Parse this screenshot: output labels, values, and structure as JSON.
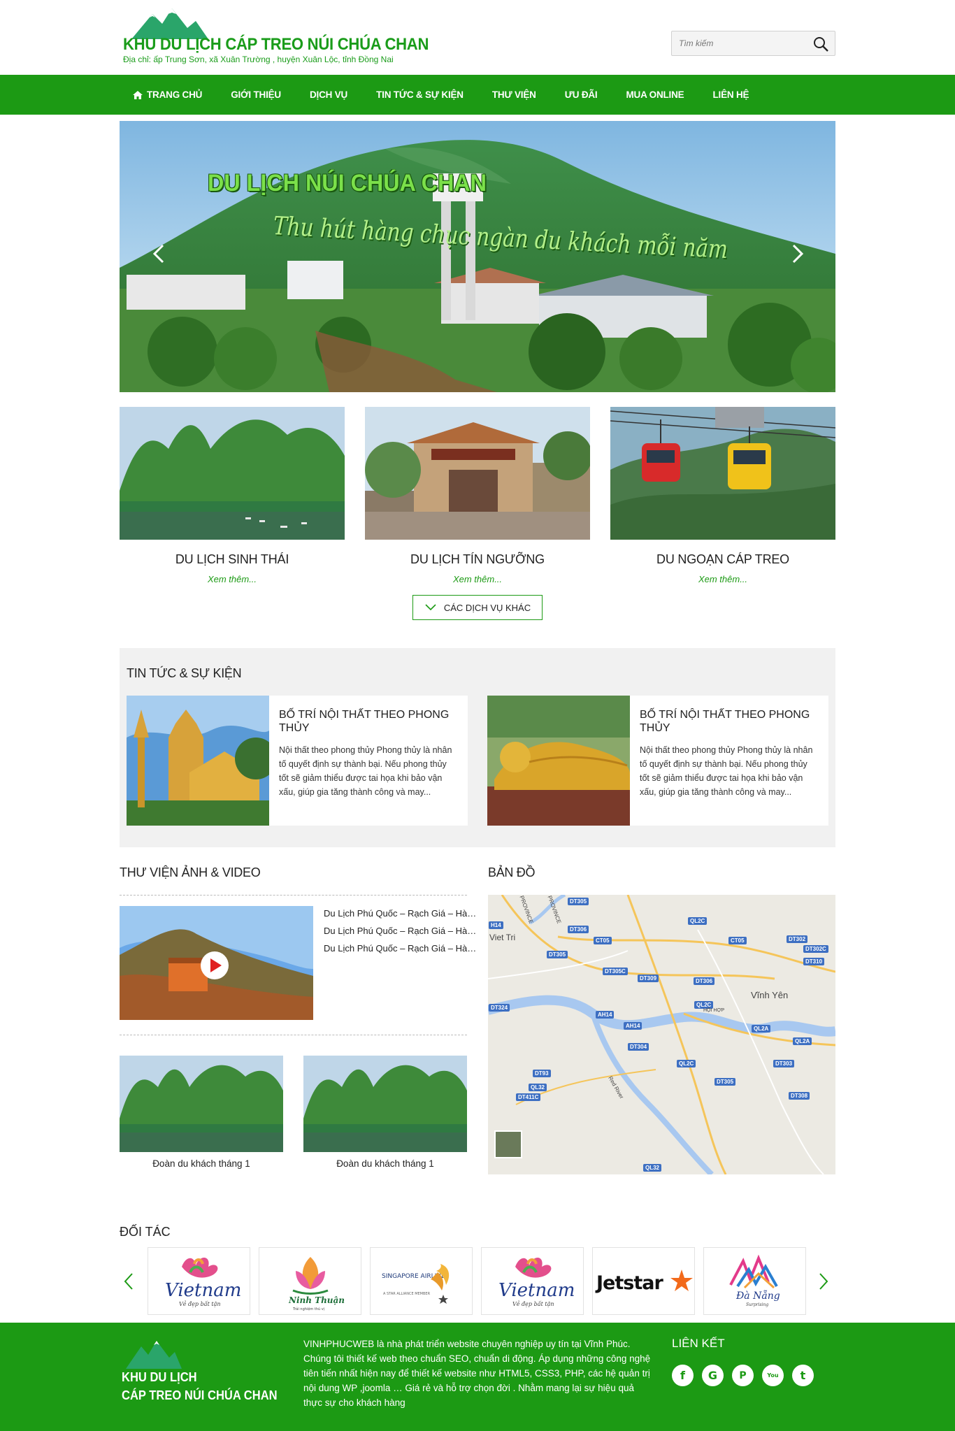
{
  "header": {
    "logo_title": "KHU DU LỊCH CÁP TREO NÚI CHÚA CHAN",
    "logo_address": "Địa chỉ: ấp Trung Sơn, xã Xuân Trường , huyện Xuân Lộc, tỉnh Đồng Nai",
    "search_placeholder": "Tìm kiếm"
  },
  "nav": [
    {
      "label": "TRANG CHỦ"
    },
    {
      "label": "GIỚI THIỆU"
    },
    {
      "label": "DỊCH VỤ"
    },
    {
      "label": "TIN TỨC & SỰ KIỆN"
    },
    {
      "label": "THƯ VIỆN"
    },
    {
      "label": "ƯU ĐÃI"
    },
    {
      "label": "MUA ONLINE"
    },
    {
      "label": "LIÊN HỆ"
    }
  ],
  "slider": {
    "title": "DU LỊCH NÚI CHÚA CHAN",
    "subtitle": "Thu hút hàng chục ngàn du khách mỗi năm"
  },
  "services": [
    {
      "title": "DU LỊCH SINH THÁI",
      "more": "Xem thêm..."
    },
    {
      "title": "DU LỊCH TÍN NGƯỠNG",
      "more": "Xem thêm..."
    },
    {
      "title": "DU NGOẠN CÁP TREO",
      "more": "Xem thêm..."
    }
  ],
  "services_more_button": "CÁC DỊCH VỤ KHÁC",
  "news": {
    "heading": "TIN TỨC & SỰ KIỆN",
    "items": [
      {
        "title": "BỐ TRÍ NỘI THẤT THEO PHONG THỦY",
        "excerpt": "Nội thất theo phong thủy Phong thủy là nhân tố quyết định sự thành bại. Nếu phong thủy tốt sẽ giảm thiểu được tai họa khi bảo vận xấu, giúp gia tăng thành công và may..."
      },
      {
        "title": "BỐ TRÍ NỘI THẤT THEO PHONG THỦY",
        "excerpt": "Nội thất theo phong thủy Phong thủy là nhân tố quyết định sự thành bại. Nếu phong thủy tốt sẽ giảm thiểu được tai họa khi bảo vận xấu, giúp gia tăng thành công và may..."
      }
    ]
  },
  "gallery": {
    "heading": "THƯ VIỆN ẢNH & VIDEO",
    "video_list": [
      "Du Lịch Phú Quốc – Rạch Giá – Hà Tiên",
      "Du Lịch Phú Quốc – Rạch Giá – Hà Tiên",
      "Du Lịch Phú Quốc – Rạch Giá – Hà Tiên"
    ],
    "thumbs": [
      {
        "caption": "Đoàn du khách tháng 1"
      },
      {
        "caption": "Đoàn du khách tháng 1"
      }
    ]
  },
  "map": {
    "heading": "BẢN ĐỒ",
    "place_labels": [
      "Viet Tri",
      "Vĩnh Yên",
      "HỘI HỢP",
      "PROVINCE",
      "PROVINCE",
      "Red River"
    ],
    "road_labels": [
      "DT305",
      "DT306",
      "QL2C",
      "DT302",
      "DT302C",
      "DT310",
      "CT05",
      "CT05",
      "DT305C",
      "DT309",
      "DT306",
      "QL2C",
      "AH14",
      "AH14",
      "DT304",
      "QL2A",
      "QL2A",
      "DT324",
      "DT93",
      "QL32",
      "DT411C",
      "QL2C",
      "DT303",
      "DT305",
      "DT308",
      "QL32",
      "H14",
      "DT305"
    ]
  },
  "partners": {
    "heading": "ĐỐI TÁC",
    "logos": [
      "Vietnam",
      "Ninh Thuận",
      "SINGAPORE AIRLINES",
      "Vietnam",
      "Jetstar",
      "Đà Nẵng"
    ],
    "logo_taglines": [
      "Vẻ đẹp bất tận",
      "Trải nghiệm thú vị",
      "A STAR ALLIANCE MEMBER",
      "Vẻ đẹp bất tận",
      "",
      "Surprising"
    ]
  },
  "footer": {
    "logo_line1": "KHU DU LỊCH",
    "logo_line2": "CÁP TREO NÚI CHÚA CHAN",
    "about": "VINHPHUCWEB là nhà phát triển website chuyên nghiệp uy tín tại Vĩnh Phúc. Chúng tôi thiết kế web theo chuẩn SEO, chuẩn di động. Áp dụng những công nghệ tiên tiến nhất hiện nay để thiết kế website như HTML5, CSS3, PHP, các hệ quản trị nội dung WP ,joomla … Giá rẻ và hỗ trợ chọn đời . Nhằm mang lại sự hiệu quả thực sự cho khách hàng",
    "links_title": "LIÊN KẾT",
    "social": [
      "f",
      "G",
      "P",
      "You",
      "t"
    ]
  },
  "colors": {
    "brand": "#1c9a14",
    "link": "#1c9a14"
  }
}
